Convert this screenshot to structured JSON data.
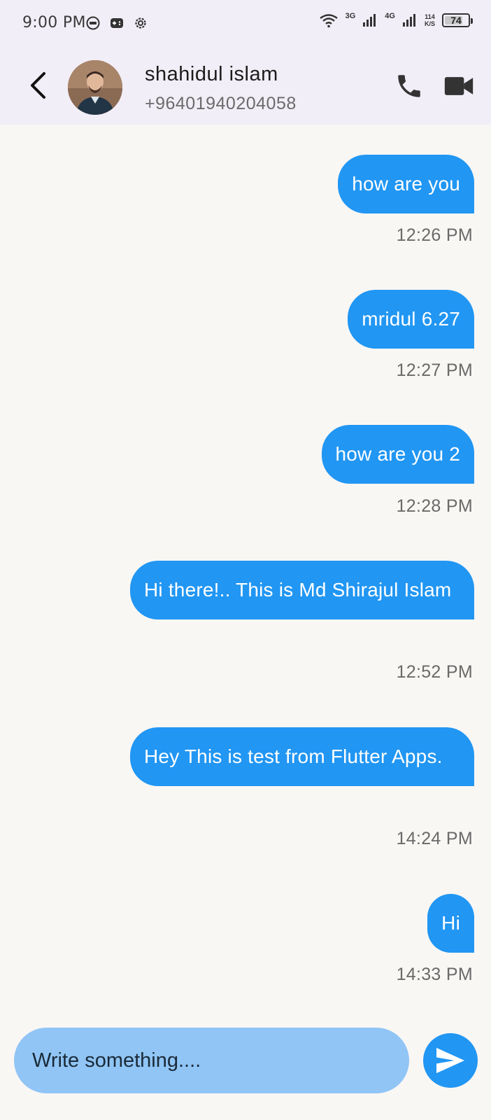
{
  "status_bar": {
    "time": "9:00 PM",
    "net1": "3G",
    "net2": "4G",
    "speed_value": "114",
    "speed_unit": "K/S",
    "battery": "74"
  },
  "header": {
    "contact_name": "shahidul islam",
    "contact_phone": "+96401940204058",
    "back_icon": "chevron-left-icon",
    "call_icon": "phone-icon",
    "video_icon": "video-camera-icon"
  },
  "messages": [
    {
      "text": "how are you",
      "time": "12:26 PM"
    },
    {
      "text": "mridul 6.27",
      "time": "12:27 PM"
    },
    {
      "text": "how are you 2",
      "time": "12:28 PM"
    },
    {
      "text": "Hi there!.. This is Md Shirajul Islam",
      "time": "12:52 PM"
    },
    {
      "text": "Hey This is test from Flutter Apps.",
      "time": "14:24 PM"
    },
    {
      "text": "Hi",
      "time": "14:33 PM"
    }
  ],
  "composer": {
    "placeholder": "Write something....",
    "value": "",
    "send_icon": "send-icon"
  },
  "colors": {
    "bubble": "#2196f3",
    "input_bg": "#90c5f5",
    "header_bg": "#f2eef7",
    "chat_bg": "#f9f7f4"
  }
}
